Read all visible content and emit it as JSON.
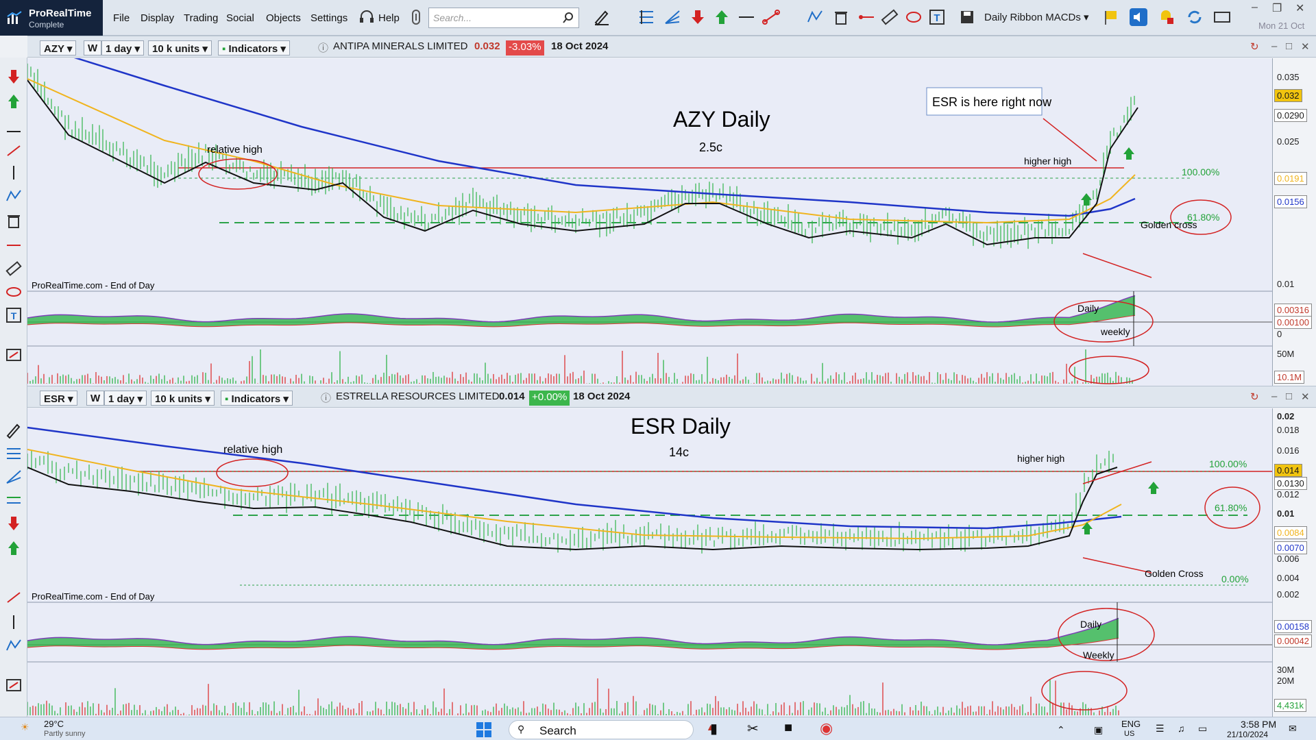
{
  "app": {
    "logo_title": "ProRealTime",
    "logo_subtitle": "Complete",
    "menu": [
      "File",
      "Display",
      "Trading",
      "Social",
      "Objects",
      "Settings",
      "Help"
    ],
    "search_placeholder": "Search...",
    "template_name": "Daily Ribbon MACDs",
    "date": "Mon 21 Oct"
  },
  "pane1": {
    "ticker": "AZY",
    "w_label": "W",
    "period": "1 day",
    "units": "10 k units",
    "indicators": "Indicators",
    "instrument_name": "ANTIPA MINERALS LIMITED",
    "last": "0.032",
    "change": "-3.03%",
    "date": "18 Oct 2024",
    "title": "AZY Daily",
    "subtitle": "2.5c",
    "source_note": "ProRealTime.com - End of Day",
    "annotations": {
      "relative_high": "relative high",
      "higher_high": "higher high",
      "now": "ESR is here right now",
      "fib_100": "100.00%",
      "fib_618": "61.80%",
      "golden": "Golden cross",
      "daily": "Daily",
      "weekly": "weekly"
    },
    "price_axis": [
      "0.035",
      "0.025",
      "0.01"
    ],
    "price_boxes": {
      "last": "0.032",
      "ma_fast": "0.0290",
      "ma_mid": "0.0191",
      "ma_slow": "0.0156"
    },
    "macd_axis": {
      "top": "0.00316",
      "bottom": "0.00100",
      "zero": "0"
    },
    "volume_axis": {
      "scale": "50M",
      "last": "10.1M"
    },
    "colors": {
      "change": "#e34a4a",
      "ma_fast": "#111111",
      "ma_mid": "#f0b41e",
      "ma_slow": "#1f35c8"
    }
  },
  "pane2": {
    "ticker": "ESR",
    "w_label": "W",
    "period": "1 day",
    "units": "10 k units",
    "indicators": "Indicators",
    "instrument_name": "ESTRELLA RESOURCES LIMITED",
    "last": "0.014",
    "change": "+0.00%",
    "date": "18 Oct 2024",
    "title": "ESR Daily",
    "subtitle": "14c",
    "source_note": "ProRealTime.com - End of Day",
    "annotations": {
      "relative_high": "relative high",
      "higher_high": "higher high",
      "fib_100": "100.00%",
      "fib_618": "61.80%",
      "fib_0": "0.00%",
      "golden": "Golden Cross",
      "daily": "Daily",
      "weekly": "Weekly"
    },
    "price_axis": [
      "0.02",
      "0.018",
      "0.016",
      "0.012",
      "0.01",
      "0.006",
      "0.004",
      "0.002"
    ],
    "price_boxes": {
      "last": "0.014",
      "ma_fast": "0.0130",
      "ma_mid": "0.0084",
      "ma_slow": "0.0070"
    },
    "macd_axis": {
      "top": "0.00158",
      "bottom": "0.00042"
    },
    "volume_axis": {
      "scale_top": "30M",
      "scale_mid": "20M",
      "last": "4,431k"
    },
    "colors": {
      "change": "#3cb64c"
    }
  },
  "taskbar": {
    "temperature": "29°C",
    "location": "Partly sunny",
    "search": "Search",
    "lang": "ENG",
    "lang_sub": "US",
    "time": "3:58 PM",
    "date": "21/10/2024"
  }
}
